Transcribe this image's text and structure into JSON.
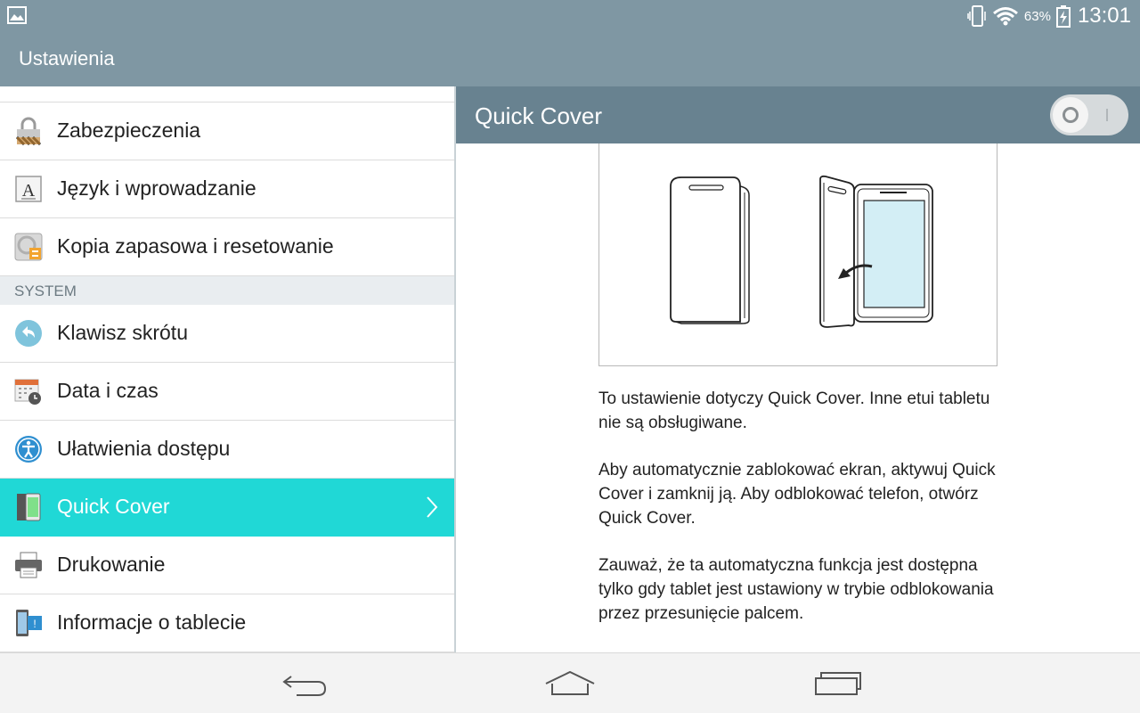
{
  "status_bar": {
    "battery_percent": "63%",
    "time": "13:01"
  },
  "action_bar": {
    "title": "Ustawienia"
  },
  "settings_menu": {
    "items": [
      {
        "label": "Zabezpieczenia",
        "icon": "lock-icon"
      },
      {
        "label": "Język i wprowadzanie",
        "icon": "language-icon"
      },
      {
        "label": "Kopia zapasowa i resetowanie",
        "icon": "backup-icon"
      }
    ],
    "section_header": "SYSTEM",
    "system_items": [
      {
        "label": "Klawisz skrótu",
        "icon": "shortcut-key-icon"
      },
      {
        "label": "Data i czas",
        "icon": "calendar-clock-icon"
      },
      {
        "label": "Ułatwienia dostępu",
        "icon": "accessibility-icon"
      },
      {
        "label": "Quick Cover",
        "icon": "quick-cover-icon",
        "selected": true
      },
      {
        "label": "Drukowanie",
        "icon": "printer-icon"
      },
      {
        "label": "Informacje o tablecie",
        "icon": "tablet-info-icon"
      }
    ]
  },
  "detail": {
    "title": "Quick Cover",
    "toggle_on": false,
    "paragraphs": [
      "To ustawienie dotyczy Quick Cover. Inne etui tabletu nie są obsługiwane.",
      "Aby automatycznie zablokować ekran, aktywuj Quick Cover i zamknij ją. Aby odblokować telefon, otwórz Quick Cover.",
      "Zauważ, że ta automatyczna funkcja jest dostępna tylko gdy tablet jest ustawiony w trybie odblokowania przez przesunięcie palcem."
    ]
  },
  "nav_bar": {
    "buttons": [
      "back-icon",
      "home-icon",
      "recent-apps-icon"
    ]
  },
  "colors": {
    "status_bar": "#7f97a3",
    "detail_header": "#688290",
    "selected_row": "#20d8d6",
    "illustration_screen": "#d3eef5"
  }
}
